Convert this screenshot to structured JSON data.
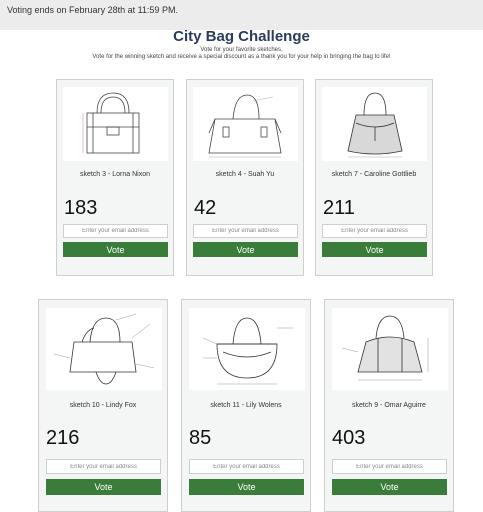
{
  "notice": "Voting ends on February 28th at 11:59 PM.",
  "header": {
    "title": "City Bag Challenge",
    "subtitle": "Vote for your favorite sketches.",
    "subtitle2": "Vote for the winning sketch and receive a special discount as a thank you for your help in bringing the bag to life!"
  },
  "email_placeholder": "Enter your email address",
  "vote_label": "Vote",
  "cards": [
    {
      "caption": "sketch 3 - Lorna Nixon",
      "votes": "183",
      "image_icon": "tote-bag-sketch"
    },
    {
      "caption": "sketch 4 - Suah Yu",
      "votes": "42",
      "image_icon": "satchel-bag-sketch"
    },
    {
      "caption": "sketch 7 - Caroline Gottlieb",
      "votes": "211",
      "image_icon": "bucket-bag-sketch"
    },
    {
      "caption": "sketch 10 - Lindy Fox",
      "votes": "216",
      "image_icon": "annotated-bag-sketch"
    },
    {
      "caption": "sketch 11 - Lily Wolens",
      "votes": "85",
      "image_icon": "round-bag-sketch"
    },
    {
      "caption": "sketch 9 - Omar Aguirre",
      "votes": "403",
      "image_icon": "dome-bag-sketch"
    }
  ]
}
